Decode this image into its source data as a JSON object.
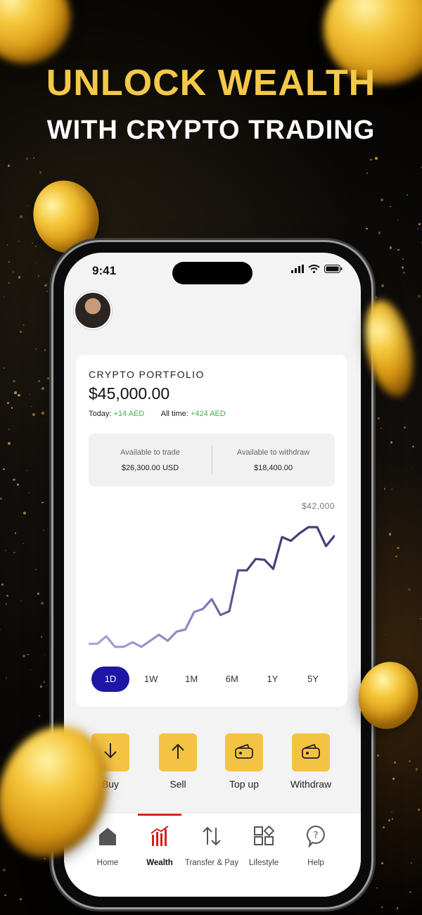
{
  "headline": {
    "line1": "UNLOCK WEALTH",
    "line2": "WITH  CRYPTO TRADING"
  },
  "status_bar": {
    "time": "9:41"
  },
  "portfolio": {
    "title": "CRYPTO PORTFOLIO",
    "value": "$45,000.00",
    "today_label": "Today:",
    "today_value": "+14 AED",
    "alltime_label": "All time:",
    "alltime_value": "+424 AED",
    "available_trade_label": "Available to trade",
    "available_trade_value": "$26,300.00 USD",
    "available_withdraw_label": "Available to withdraw",
    "available_withdraw_value": "$18,400.00",
    "chart_max_label": "$42,000"
  },
  "chart_data": {
    "type": "line",
    "y": [
      21600,
      21600,
      22600,
      21200,
      21200,
      21800,
      21200,
      22000,
      22800,
      22000,
      23200,
      23500,
      25800,
      26200,
      27500,
      25400,
      25900,
      31300,
      31300,
      32800,
      32700,
      31500,
      35700,
      35200,
      36200,
      37000,
      37000,
      34500,
      35900
    ],
    "colors": {
      "early": "#a9a2d6",
      "late": "#463f78"
    }
  },
  "time_ranges": [
    "1D",
    "1W",
    "1M",
    "6M",
    "1Y",
    "5Y"
  ],
  "active_range": "1D",
  "actions": [
    {
      "label": "Buy",
      "icon": "arrow-down-icon"
    },
    {
      "label": "Sell",
      "icon": "arrow-up-icon"
    },
    {
      "label": "Top up",
      "icon": "wallet-icon"
    },
    {
      "label": "Withdraw",
      "icon": "wallet-icon"
    }
  ],
  "tabs": [
    {
      "label": "Home",
      "icon": "home-icon"
    },
    {
      "label": "Wealth",
      "icon": "chart-bars-icon"
    },
    {
      "label": "Transfer & Pay",
      "icon": "transfer-arrows-icon"
    },
    {
      "label": "Lifestyle",
      "icon": "grid-apps-icon"
    },
    {
      "label": "Help",
      "icon": "help-bubble-icon"
    }
  ],
  "colors": {
    "accent_gold": "#f4c84a",
    "range_active": "#1d16a6",
    "positive": "#43b150",
    "tab_indicator": "#e02020"
  }
}
